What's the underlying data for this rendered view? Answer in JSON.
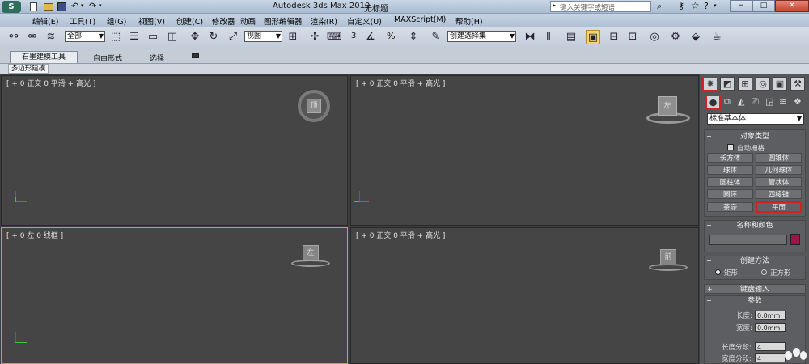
{
  "title": {
    "app": "Autodesk 3ds Max  2010",
    "doc": "无标题",
    "search_placeholder": "键入关键字或短语"
  },
  "menu": [
    "编辑(E)",
    "工具(T)",
    "组(G)",
    "视图(V)",
    "创建(C)",
    "修改器",
    "动画",
    "图形编辑器",
    "渲染(R)",
    "自定义(U)",
    "MAXScript(M)",
    "帮助(H)"
  ],
  "toolbar": {
    "filter": "全部",
    "refsys": "视图",
    "selset": "创建选择集",
    "snap_label": "3",
    "pct_label": "%"
  },
  "ribbon": {
    "tabs": [
      "石墨建模工具",
      "自由形式",
      "选择"
    ],
    "sub": "多边形建模"
  },
  "viewports": {
    "top": "[ + 0 正交 0 平滑 + 高光 ]",
    "persp": "[ + 0 正交 0 平滑 + 高光 ]",
    "left": "[ + 0 左 0 线框 ]",
    "bottom_right": "[ + 0 正交 0 平滑 + 高光 ]",
    "top_cube": "顶",
    "persp_cube": "左",
    "left_cube": "左",
    "br_cube": "前"
  },
  "panel": {
    "dropdown": "标准基本体",
    "object_type": "对象类型",
    "autogrid": "自动栅格",
    "buttons": [
      "长方体",
      "圆锥体",
      "球体",
      "几何球体",
      "圆柱体",
      "管状体",
      "圆环",
      "四棱锥",
      "茶壶",
      "平面"
    ],
    "name_color": "名称和颜色",
    "create_method": "创建方法",
    "radio1": "矩形",
    "radio2": "正方形",
    "keyboard": "键盘输入",
    "params": "参数",
    "length": "长度:",
    "width": "宽度:",
    "length_val": "0.0mm",
    "width_val": "0.0mm",
    "length_seg": "长度分段:",
    "width_seg": "宽度分段:",
    "seg_val": "4",
    "object_color": "#a0124a"
  }
}
